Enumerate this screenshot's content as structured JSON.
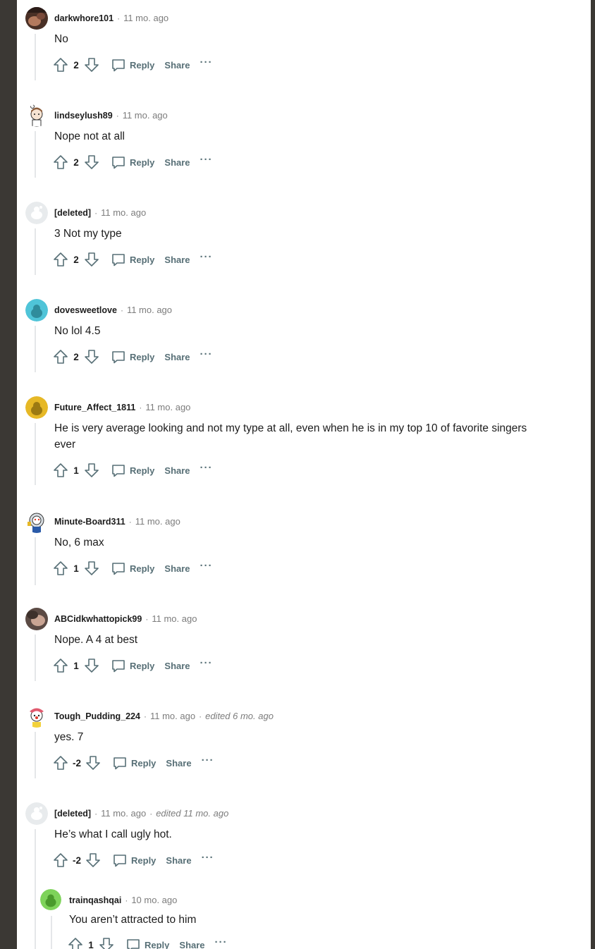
{
  "colors": {
    "accent_avatar_teal": "#4fc4d8",
    "accent_avatar_gold": "#e6b826",
    "accent_avatar_green": "#7ed35a",
    "meta_gray": "#7c7c7c",
    "action_gray": "#576f76",
    "thread_line": "#e5e7e9"
  },
  "comments": [
    {
      "author": "darkwhore101",
      "time": "11 mo. ago",
      "edited": "",
      "body": "No",
      "score": "2",
      "reply": "Reply",
      "share": "Share",
      "more": "···",
      "avatar": "photo-avatar"
    },
    {
      "author": "lindseylush89",
      "time": "11 mo. ago",
      "edited": "",
      "body": "Nope not at all",
      "score": "2",
      "reply": "Reply",
      "share": "Share",
      "more": "···",
      "avatar": "cartoon-avatar"
    },
    {
      "author": "[deleted]",
      "time": "11 mo. ago",
      "edited": "",
      "body": "3 Not my type",
      "score": "2",
      "reply": "Reply",
      "share": "Share",
      "more": "···",
      "avatar": "deleted-avatar"
    },
    {
      "author": "dovesweetlove",
      "time": "11 mo. ago",
      "edited": "",
      "body": "No lol 4.5",
      "score": "2",
      "reply": "Reply",
      "share": "Share",
      "more": "···",
      "avatar": "snoo-teal-avatar"
    },
    {
      "author": "Future_Affect_1811",
      "time": "11 mo. ago",
      "edited": "",
      "body": "He is very average looking and not my type at all, even when he is in my top 10 of favorite singers ever",
      "score": "1",
      "reply": "Reply",
      "share": "Share",
      "more": "···",
      "avatar": "snoo-gold-avatar"
    },
    {
      "author": "Minute-Board311",
      "time": "11 mo. ago",
      "edited": "",
      "body": "No, 6 max",
      "score": "1",
      "reply": "Reply",
      "share": "Share",
      "more": "···",
      "avatar": "snoo-astronaut-avatar"
    },
    {
      "author": "ABCidkwhattopick99",
      "time": "11 mo. ago",
      "edited": "",
      "body": "Nope. A 4 at best",
      "score": "1",
      "reply": "Reply",
      "share": "Share",
      "more": "···",
      "avatar": "photo-avatar"
    },
    {
      "author": "Tough_Pudding_224",
      "time": "11 mo. ago",
      "edited": "edited 6 mo. ago",
      "body": "yes. 7",
      "score": "-2",
      "reply": "Reply",
      "share": "Share",
      "more": "···",
      "avatar": "snoo-clown-avatar"
    },
    {
      "author": "[deleted]",
      "time": "11 mo. ago",
      "edited": "edited 11 mo. ago",
      "body": "He’s what I call ugly hot.",
      "score": "-2",
      "reply": "Reply",
      "share": "Share",
      "more": "···",
      "avatar": "deleted-avatar"
    }
  ],
  "nested_reply": {
    "author": "trainqashqai",
    "time": "10 mo. ago",
    "body": "You aren’t attracted to him",
    "score": "1",
    "reply": "Reply",
    "share": "Share",
    "more": "···",
    "avatar": "snoo-green-avatar"
  },
  "separator": "·"
}
